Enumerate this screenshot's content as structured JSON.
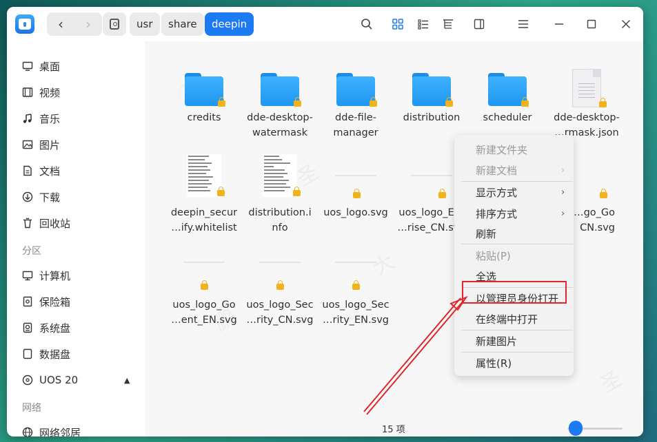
{
  "window": {
    "breadcrumbs": [
      "usr",
      "share",
      "deepin"
    ],
    "active_crumb": "deepin"
  },
  "sidebar": {
    "items": [
      {
        "label": "桌面",
        "icon": "desktop-icon"
      },
      {
        "label": "视频",
        "icon": "video-icon"
      },
      {
        "label": "音乐",
        "icon": "music-icon"
      },
      {
        "label": "图片",
        "icon": "picture-icon"
      },
      {
        "label": "文档",
        "icon": "document-icon"
      },
      {
        "label": "下载",
        "icon": "download-icon"
      },
      {
        "label": "回收站",
        "icon": "trash-icon"
      }
    ],
    "section_partitions": "分区",
    "partitions": [
      {
        "label": "计算机",
        "icon": "computer-icon"
      },
      {
        "label": "保险箱",
        "icon": "vault-icon"
      },
      {
        "label": "系统盘",
        "icon": "disk-icon"
      },
      {
        "label": "数据盘",
        "icon": "disk-icon"
      },
      {
        "label": "UOS 20",
        "icon": "optical-disc-icon"
      }
    ],
    "section_network": "网络",
    "network": [
      {
        "label": "网络邻居",
        "icon": "network-icon"
      }
    ]
  },
  "files": [
    {
      "line1": "credits",
      "line2": "",
      "kind": "folder"
    },
    {
      "line1": "dde-desktop-",
      "line2": "watermask",
      "kind": "folder"
    },
    {
      "line1": "dde-file-",
      "line2": "manager",
      "kind": "folder"
    },
    {
      "line1": "distribution",
      "line2": "",
      "kind": "folder"
    },
    {
      "line1": "scheduler",
      "line2": "",
      "kind": "folder"
    },
    {
      "line1": "dde-desktop-",
      "line2": "…rmask.json",
      "kind": "json"
    },
    {
      "line1": "deepin_secur",
      "line2": "…ify.whitelist",
      "kind": "text"
    },
    {
      "line1": "distribution.i",
      "line2": "nfo",
      "kind": "text"
    },
    {
      "line1": "uos_logo.svg",
      "line2": "",
      "kind": "svg"
    },
    {
      "line1": "uos_logo_Ent",
      "line2": "…rise_CN.svg",
      "kind": "svg"
    },
    {
      "line1": "…go_Go",
      "line2": "CN.svg",
      "kind": "svg"
    },
    {
      "line1": "uos_logo_Go",
      "line2": "…ent_EN.svg",
      "kind": "svg"
    },
    {
      "line1": "uos_logo_Sec",
      "line2": "…rity_CN.svg",
      "kind": "svg"
    },
    {
      "line1": "uos_logo_Sec",
      "line2": "…rity_EN.svg",
      "kind": "svg"
    }
  ],
  "context_menu": {
    "items": [
      {
        "label": "新建文件夹",
        "disabled": true,
        "submenu": false
      },
      {
        "label": "新建文档",
        "disabled": true,
        "submenu": true
      },
      {
        "label": "显示方式",
        "disabled": false,
        "submenu": true
      },
      {
        "label": "排序方式",
        "disabled": false,
        "submenu": true
      },
      {
        "label": "刷新",
        "disabled": false,
        "submenu": false
      },
      {
        "label": "粘贴(P)",
        "disabled": true,
        "submenu": false
      },
      {
        "label": "全选",
        "disabled": false,
        "submenu": false
      },
      {
        "label": "以管理员身份打开",
        "disabled": false,
        "submenu": false,
        "highlighted": true
      },
      {
        "label": "在终端中打开",
        "disabled": false,
        "submenu": false
      },
      {
        "label": "新建图片",
        "disabled": false,
        "submenu": false
      },
      {
        "label": "属性(R)",
        "disabled": false,
        "submenu": false
      }
    ]
  },
  "status": {
    "item_count": "15 项"
  },
  "colors": {
    "accent": "#1c7bf2",
    "folder": "#2aa2f8",
    "lock": "#f2b31a",
    "annotation": "#e0262b"
  }
}
